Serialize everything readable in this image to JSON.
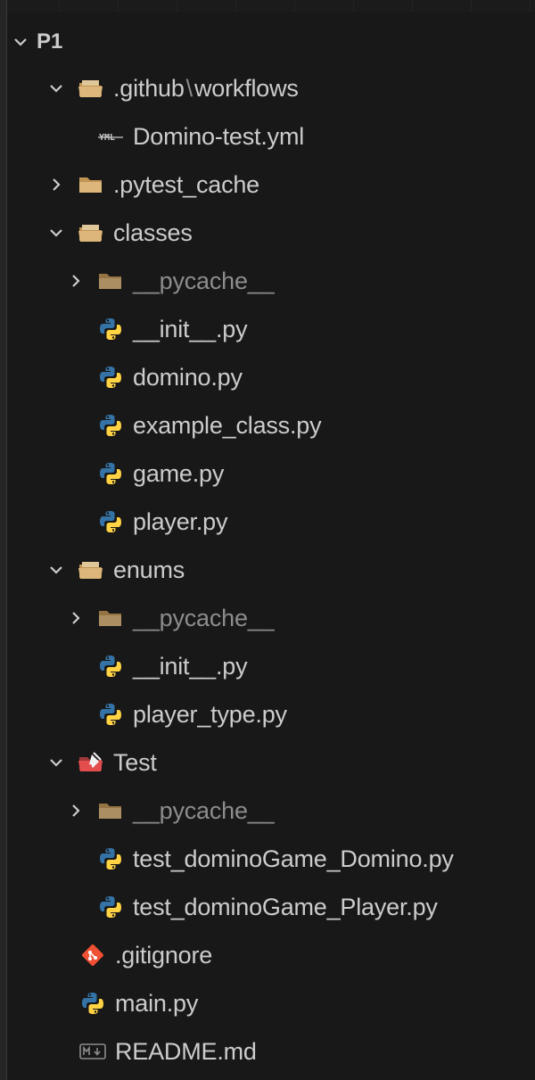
{
  "explorer": {
    "root": {
      "label": "P1",
      "expanded": true
    },
    "items": [
      {
        "id": "github",
        "label": ".github",
        "sub_label": "workflows",
        "separator": "\\",
        "type": "folder-open"
      },
      {
        "id": "domino-test",
        "label": "Domino-test.yml",
        "type": "yaml-file"
      },
      {
        "id": "pytest-cache",
        "label": ".pytest_cache",
        "type": "folder-closed"
      },
      {
        "id": "classes",
        "label": "classes",
        "type": "folder-open"
      },
      {
        "id": "classes-pycache",
        "label": "__pycache__",
        "type": "folder-closed",
        "dimmed": true
      },
      {
        "id": "classes-init",
        "label": "__init__.py",
        "type": "python-file"
      },
      {
        "id": "domino",
        "label": "domino.py",
        "type": "python-file"
      },
      {
        "id": "example-class",
        "label": "example_class.py",
        "type": "python-file"
      },
      {
        "id": "game",
        "label": "game.py",
        "type": "python-file"
      },
      {
        "id": "player",
        "label": "player.py",
        "type": "python-file"
      },
      {
        "id": "enums",
        "label": "enums",
        "type": "folder-open"
      },
      {
        "id": "enums-pycache",
        "label": "__pycache__",
        "type": "folder-closed",
        "dimmed": true
      },
      {
        "id": "enums-init",
        "label": "__init__.py",
        "type": "python-file"
      },
      {
        "id": "player-type",
        "label": "player_type.py",
        "type": "python-file"
      },
      {
        "id": "test",
        "label": "Test",
        "type": "test-folder-open"
      },
      {
        "id": "test-pycache",
        "label": "__pycache__",
        "type": "folder-closed",
        "dimmed": true
      },
      {
        "id": "test-domino",
        "label": "test_dominoGame_Domino.py",
        "type": "python-file"
      },
      {
        "id": "test-player",
        "label": "test_dominoGame_Player.py",
        "type": "python-file"
      },
      {
        "id": "gitignore",
        "label": ".gitignore",
        "type": "git-file"
      },
      {
        "id": "main",
        "label": "main.py",
        "type": "python-file"
      },
      {
        "id": "readme",
        "label": "README.md",
        "type": "markdown-file"
      }
    ]
  },
  "colors": {
    "background": "#181818",
    "text": "#cccccc",
    "dimmed_text": "#8c8c8c",
    "folder": "#c09553",
    "python_blue": "#3572a5",
    "python_yellow": "#ffd343",
    "git_red": "#f05033",
    "test_folder_red": "#e44d4d"
  },
  "icons": {
    "chevron_expanded": "chevron-down-icon",
    "chevron_collapsed": "chevron-right-icon",
    "folder_open": "folder-open-icon",
    "folder_closed": "folder-icon",
    "yaml": "yaml-icon",
    "python": "python-icon",
    "test_folder": "test-folder-icon",
    "git": "git-icon",
    "markdown": "markdown-icon"
  }
}
